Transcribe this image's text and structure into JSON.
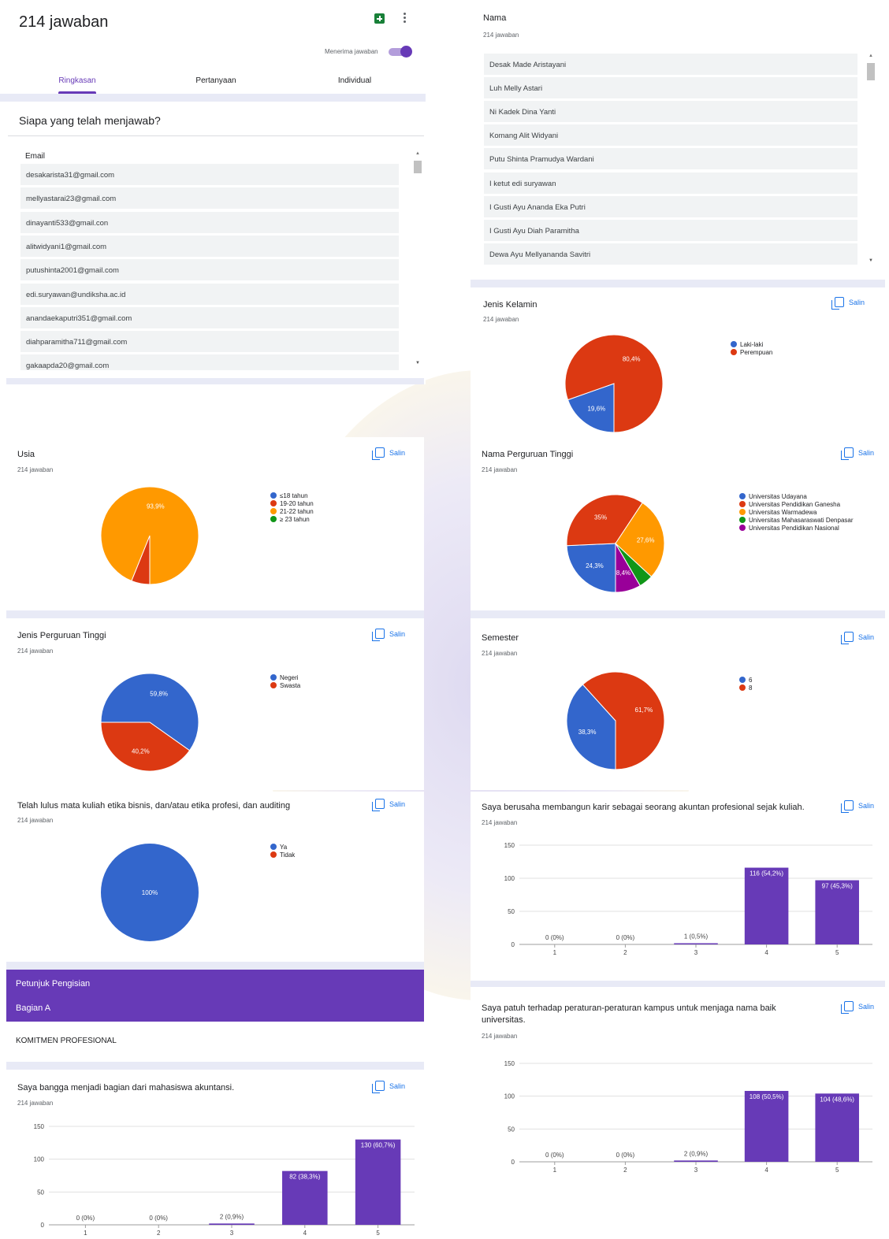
{
  "header": {
    "title": "214 jawaban",
    "accepting_label": "Menerima jawaban",
    "tabs": [
      "Ringkasan",
      "Pertanyaan",
      "Individual"
    ]
  },
  "respondents": {
    "title": "Siapa yang telah menjawab?",
    "column": "Email",
    "emails": [
      "desakarista31@gmail.com",
      "mellyastarai23@gmail.com",
      "dinayanti533@gmail.con",
      "alitwidyani1@gmail.com",
      "putushinta2001@gmail.com",
      "edi.suryawan@undiksha.ac.id",
      "anandaekaputri351@gmail.com",
      "diahparamitha711@gmail.com",
      "gakaapda20@gmail.com"
    ]
  },
  "nama": {
    "title": "Nama",
    "count": "214 jawaban",
    "names": [
      "Desak Made Aristayani",
      "Luh Melly Astari",
      "Ni Kadek Dina Yanti",
      "Komang Alit Widyani",
      "Putu Shinta Pramudya Wardani",
      "I ketut edi suryawan",
      "I Gusti Ayu Ananda Eka Putri",
      "I Gusti Ayu Diah Paramitha",
      "Dewa Ayu Mellyananda Savitri"
    ]
  },
  "copy_label": "Salin",
  "section": {
    "petunjuk": "Petunjuk Pengisian",
    "bagian": "Bagian A",
    "heading": "KOMITMEN PROFESIONAL"
  },
  "questions": {
    "gender": {
      "title": "Jenis Kelamin",
      "count": "214 jawaban"
    },
    "age": {
      "title": "Usia",
      "count": "214 jawaban"
    },
    "univ": {
      "title": "Nama Perguruan Tinggi",
      "count": "214 jawaban"
    },
    "univtype": {
      "title": "Jenis Perguruan Tinggi",
      "count": "214 jawaban"
    },
    "semester": {
      "title": "Semester",
      "count": "214 jawaban"
    },
    "lulus": {
      "title": "Telah lulus mata kuliah etika bisnis, dan/atau etika profesi, dan auditing",
      "count": "214 jawaban"
    },
    "karir": {
      "title": "Saya berusaha membangun karir sebagai seorang akuntan profesional sejak kuliah.",
      "count": "214 jawaban"
    },
    "bangga": {
      "title": "Saya bangga menjadi bagian dari mahasiswa akuntansi.",
      "count": "214 jawaban"
    },
    "patuh": {
      "title": "Saya patuh terhadap peraturan-peraturan kampus untuk menjaga nama baik universitas.",
      "count": "214 jawaban"
    }
  },
  "chart_data": [
    {
      "id": "gender",
      "type": "pie",
      "labels": [
        "Laki-laki",
        "Perempuan"
      ],
      "values": [
        19.6,
        80.4
      ],
      "slice_labels": [
        "19,6%",
        "80,4%"
      ],
      "colors": [
        "#3366cc",
        "#dc3912"
      ],
      "legend_position": "right"
    },
    {
      "id": "age",
      "type": "pie",
      "labels": [
        "≤18 tahun",
        "19-20 tahun",
        "21-22 tahun",
        "≥ 23 tahun"
      ],
      "values": [
        0,
        6.1,
        93.9,
        0
      ],
      "slice_labels": [
        "",
        "",
        "93,9%",
        ""
      ],
      "colors": [
        "#3366cc",
        "#dc3912",
        "#ff9900",
        "#109618"
      ],
      "legend_position": "right"
    },
    {
      "id": "univ",
      "type": "pie",
      "labels": [
        "Universitas Udayana",
        "Universitas Pendidikan Ganesha",
        "Universitas Warmadewa",
        "Universitas Mahasaraswati Denpasar",
        "Universitas Pendidikan Nasional"
      ],
      "values": [
        24.3,
        35,
        27.6,
        4.7,
        8.4
      ],
      "slice_labels": [
        "24,3%",
        "35%",
        "27,6%",
        "",
        "8,4%"
      ],
      "colors": [
        "#3366cc",
        "#dc3912",
        "#ff9900",
        "#109618",
        "#990099"
      ],
      "legend_position": "right"
    },
    {
      "id": "univtype",
      "type": "pie",
      "labels": [
        "Negeri",
        "Swasta"
      ],
      "values": [
        59.8,
        40.2
      ],
      "slice_labels": [
        "59,8%",
        "40,2%"
      ],
      "colors": [
        "#3366cc",
        "#dc3912"
      ],
      "legend_position": "right"
    },
    {
      "id": "semester",
      "type": "pie",
      "labels": [
        "6",
        "8"
      ],
      "values": [
        38.3,
        61.7
      ],
      "slice_labels": [
        "38,3%",
        "61,7%"
      ],
      "colors": [
        "#3366cc",
        "#dc3912"
      ],
      "legend_position": "right"
    },
    {
      "id": "lulus",
      "type": "pie",
      "labels": [
        "Ya",
        "Tidak"
      ],
      "values": [
        100,
        0
      ],
      "slice_labels": [
        "100%",
        ""
      ],
      "colors": [
        "#3366cc",
        "#dc3912"
      ],
      "legend_position": "right"
    },
    {
      "id": "karir",
      "type": "bar",
      "categories": [
        "1",
        "2",
        "3",
        "4",
        "5"
      ],
      "values": [
        0,
        0,
        1,
        116,
        97
      ],
      "labels": [
        "0 (0%)",
        "0 (0%)",
        "1 (0,5%)",
        "116 (54,2%)",
        "97 (45,3%)"
      ],
      "ylim": [
        0,
        150
      ],
      "yticks": [
        0,
        50,
        100,
        150
      ],
      "color": "#673ab7"
    },
    {
      "id": "bangga",
      "type": "bar",
      "categories": [
        "1",
        "2",
        "3",
        "4",
        "5"
      ],
      "values": [
        0,
        0,
        2,
        82,
        130
      ],
      "labels": [
        "0 (0%)",
        "0 (0%)",
        "2 (0,9%)",
        "82 (38,3%)",
        "130 (60,7%)"
      ],
      "ylim": [
        0,
        150
      ],
      "yticks": [
        0,
        50,
        100,
        150
      ],
      "color": "#673ab7"
    },
    {
      "id": "patuh",
      "type": "bar",
      "categories": [
        "1",
        "2",
        "3",
        "4",
        "5"
      ],
      "values": [
        0,
        0,
        2,
        108,
        104
      ],
      "labels": [
        "0 (0%)",
        "0 (0%)",
        "2 (0,9%)",
        "108 (50,5%)",
        "104 (48,6%)"
      ],
      "ylim": [
        0,
        150
      ],
      "yticks": [
        0,
        50,
        100,
        150
      ],
      "color": "#673ab7"
    }
  ]
}
